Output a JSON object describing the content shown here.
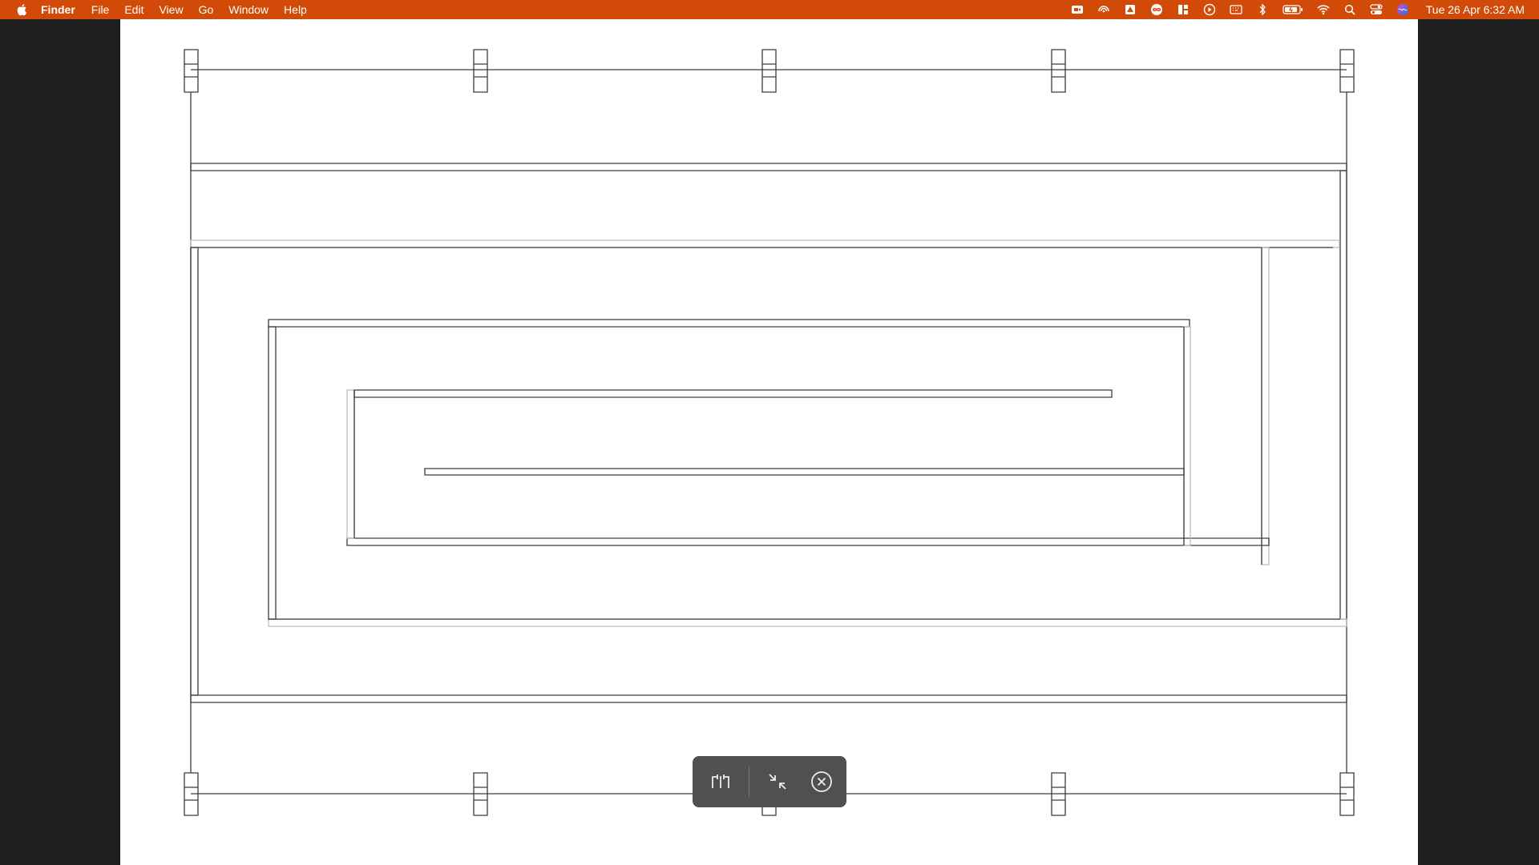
{
  "menubar": {
    "apple_icon": "apple-logo-icon",
    "app_name": "Finder",
    "items": [
      "File",
      "Edit",
      "View",
      "Go",
      "Window",
      "Help"
    ],
    "status_icons": [
      "video-icon",
      "airdrop-icon",
      "drive-icon",
      "infinity-icon",
      "layout-icon",
      "play-icon",
      "keyboard-icon",
      "bluetooth-icon",
      "battery-icon",
      "wifi-icon",
      "search-icon",
      "control-center-icon",
      "siri-icon"
    ],
    "clock": "Tue 26 Apr  6:32 AM"
  },
  "toolbar": {
    "buttons": [
      "split-view-icon",
      "exit-fullscreen-icon",
      "close-circle-icon"
    ]
  },
  "colors": {
    "menubar_bg": "#d24a07",
    "desktop_bg": "#1e1e1e",
    "canvas_bg": "#ffffff",
    "toolbar_bg": "#505050"
  }
}
